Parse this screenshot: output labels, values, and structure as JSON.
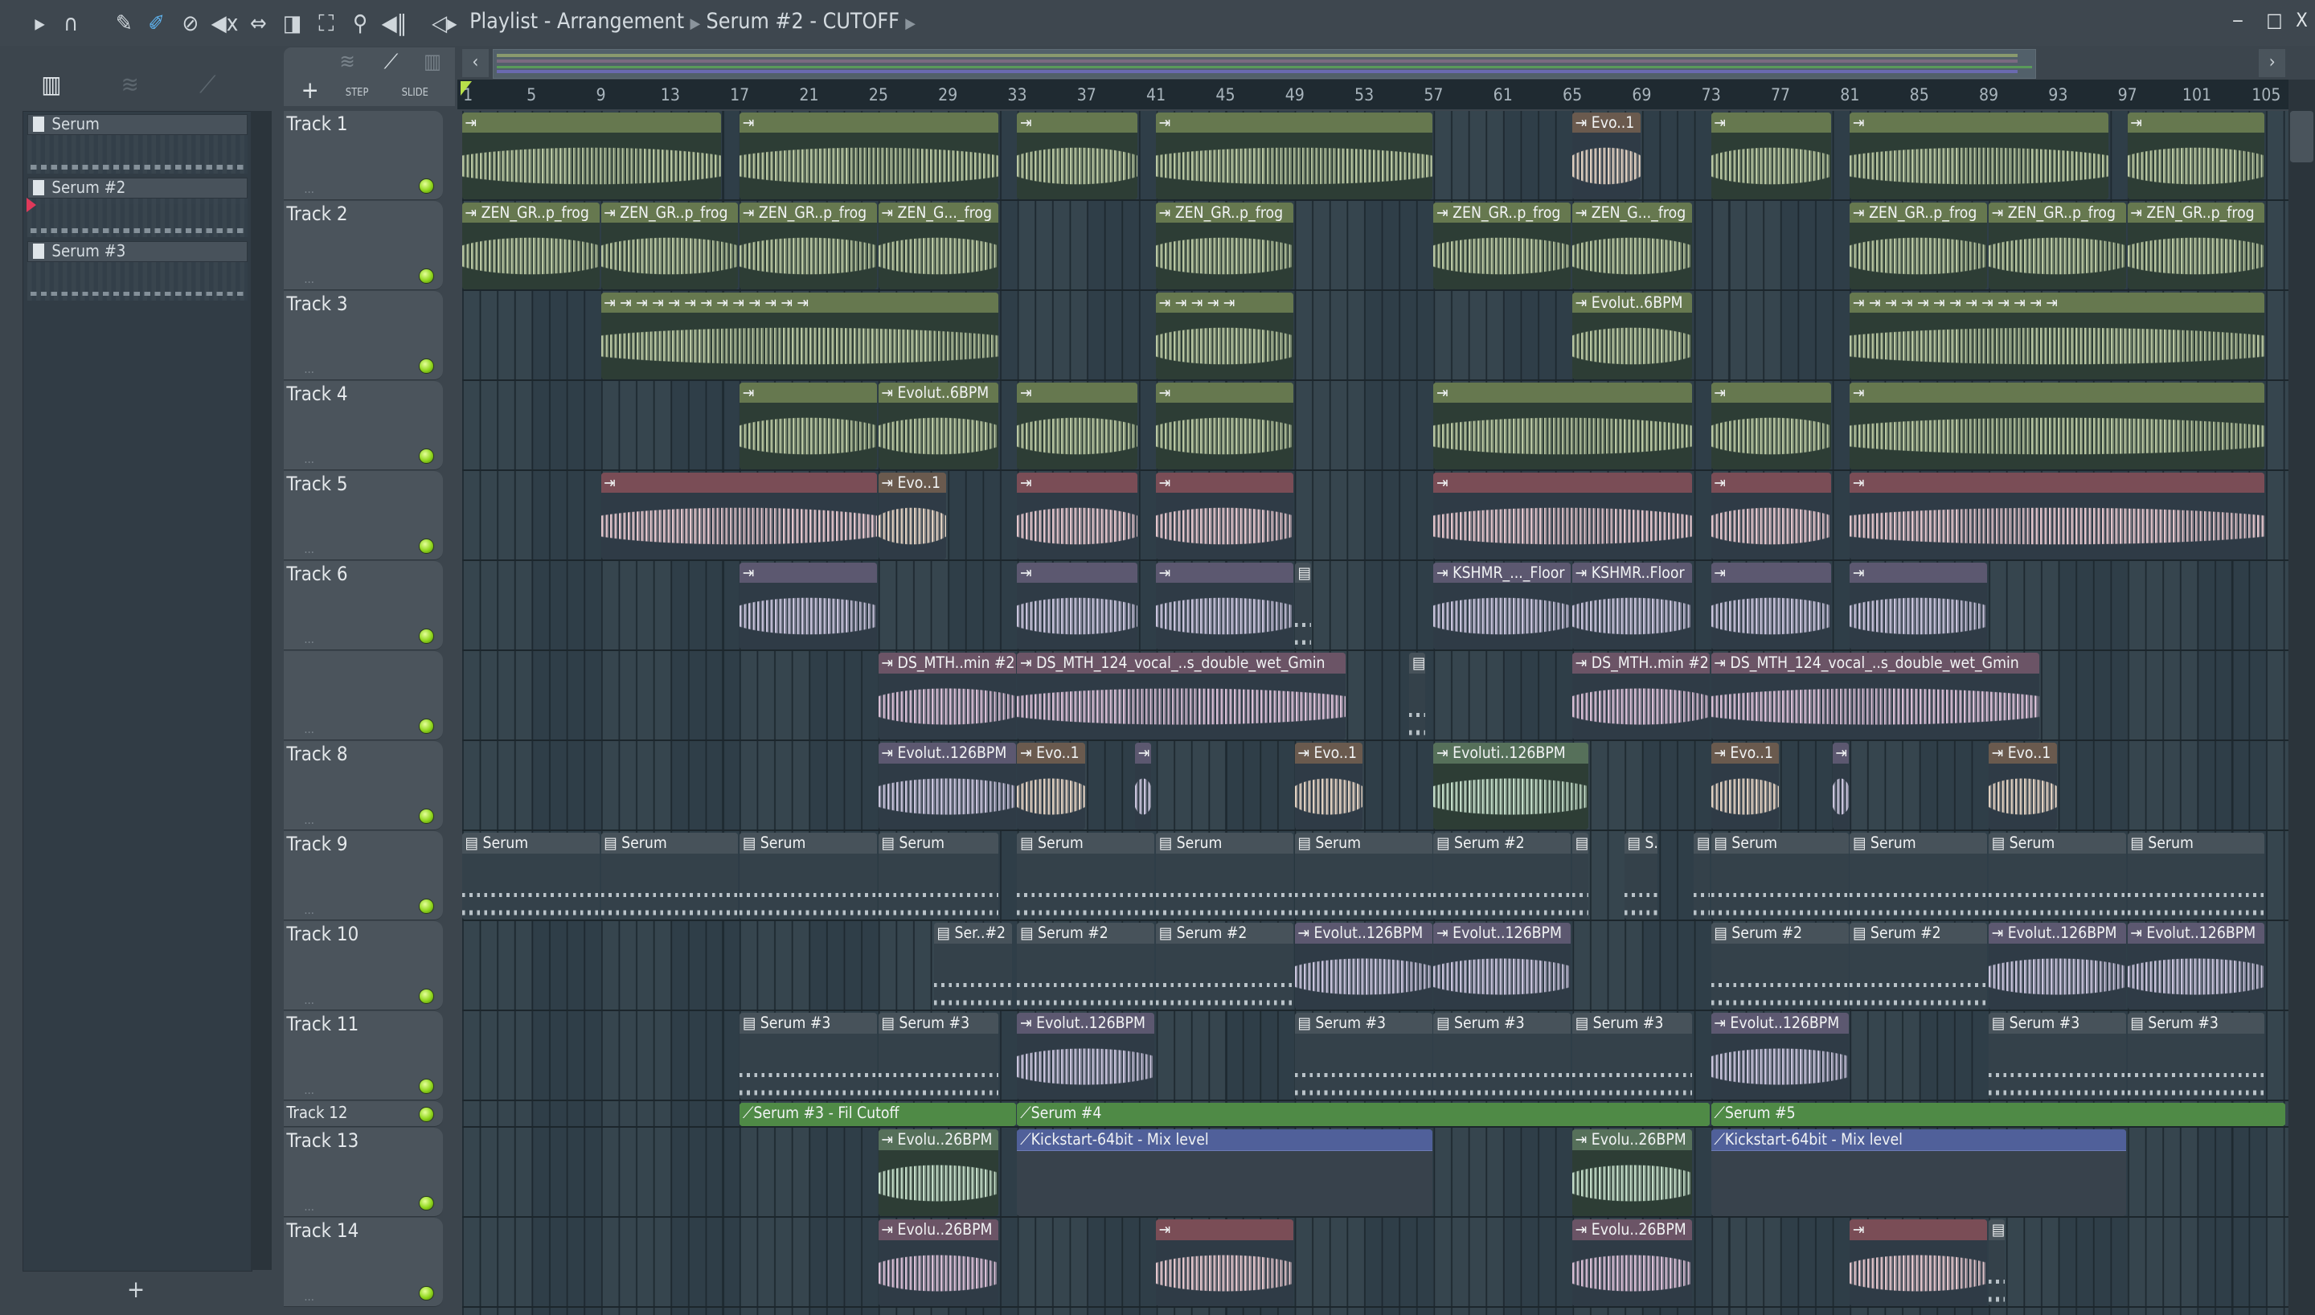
{
  "window": {
    "title": "Playlist - Arrangement",
    "pattern": "Serum #2 - CUTOFF",
    "minimize": "‒",
    "maximize": "□",
    "close": "X"
  },
  "toolbar": {
    "icons": [
      "play-arrow-icon",
      "magnet-snap-icon",
      "pencil-draw-icon",
      "paint-brush-icon",
      "delete-icon",
      "mute-icon",
      "slip-icon",
      "slice-icon",
      "select-icon",
      "zoom-icon",
      "playback-icon",
      "speaker-icon"
    ],
    "step_label": "STEP",
    "slide_label": "SLIDE",
    "add_label": "+"
  },
  "picker": {
    "patterns": [
      {
        "name": "Serum"
      },
      {
        "name": "Serum #2"
      },
      {
        "name": "Serum #3"
      }
    ],
    "add_label": "+"
  },
  "ruler": {
    "bars": [
      "1",
      "5",
      "9",
      "13",
      "17",
      "21",
      "25",
      "29",
      "33",
      "37",
      "41",
      "45",
      "49",
      "53",
      "57",
      "61",
      "65",
      "69",
      "73",
      "77",
      "81",
      "85",
      "89",
      "93",
      "97",
      "101",
      "105"
    ]
  },
  "colors": {
    "olive": "#66784f",
    "mint": "#b9c7a2",
    "pink": "#6b5466",
    "vocal": "#d9bfd6",
    "purple": "#5c5870",
    "brown": "#6a5a4e",
    "grey": "#47525a",
    "auto_green": "#4f8a46",
    "auto_blue": "#50609a",
    "red": "#7a4d56"
  },
  "tracks": [
    {
      "name": "Track 1",
      "clips": [
        {
          "s": 1,
          "l": 15,
          "t": "olive",
          "label": ""
        },
        {
          "s": 17,
          "l": 15,
          "t": "olive",
          "label": ""
        },
        {
          "s": 33,
          "l": 7,
          "t": "olive",
          "label": ""
        },
        {
          "s": 41,
          "l": 16,
          "t": "olive",
          "label": ""
        },
        {
          "s": 65,
          "l": 4,
          "t": "brown",
          "label": "Evo..1"
        },
        {
          "s": 73,
          "l": 7,
          "t": "olive",
          "label": ""
        },
        {
          "s": 81,
          "l": 15,
          "t": "olive",
          "label": ""
        },
        {
          "s": 97,
          "l": 8,
          "t": "olive",
          "label": ""
        }
      ]
    },
    {
      "name": "Track 2",
      "clips": [
        {
          "s": 1,
          "l": 8,
          "t": "olive",
          "label": "ZEN_GR..p_frog"
        },
        {
          "s": 9,
          "l": 8,
          "t": "olive",
          "label": "ZEN_GR..p_frog"
        },
        {
          "s": 17,
          "l": 8,
          "t": "olive",
          "label": "ZEN_GR..p_frog"
        },
        {
          "s": 25,
          "l": 7,
          "t": "olive",
          "label": "ZEN_G..._frog"
        },
        {
          "s": 41,
          "l": 8,
          "t": "olive",
          "label": "ZEN_GR..p_frog"
        },
        {
          "s": 57,
          "l": 8,
          "t": "olive",
          "label": "ZEN_GR..p_frog"
        },
        {
          "s": 65,
          "l": 7,
          "t": "olive",
          "label": "ZEN_G..._frog"
        },
        {
          "s": 81,
          "l": 8,
          "t": "olive",
          "label": "ZEN_GR..p_frog"
        },
        {
          "s": 89,
          "l": 8,
          "t": "olive",
          "label": "ZEN_GR..p_frog"
        },
        {
          "s": 97,
          "l": 8,
          "t": "olive",
          "label": "ZEN_GR..p_frog"
        }
      ]
    },
    {
      "name": "Track 3",
      "clips": [
        {
          "s": 9,
          "l": 23,
          "t": "olive",
          "label": "⇥ ⇥ ⇥ ⇥ ⇥ ⇥ ⇥ ⇥ ⇥ ⇥ ⇥ ⇥"
        },
        {
          "s": 41,
          "l": 8,
          "t": "olive",
          "label": "⇥ ⇥ ⇥ ⇥"
        },
        {
          "s": 65,
          "l": 7,
          "t": "olive",
          "label": "Evolut..6BPM"
        },
        {
          "s": 81,
          "l": 24,
          "t": "olive",
          "label": "⇥ ⇥ ⇥ ⇥ ⇥ ⇥ ⇥ ⇥ ⇥ ⇥ ⇥ ⇥"
        }
      ]
    },
    {
      "name": "Track 4",
      "clips": [
        {
          "s": 17,
          "l": 8,
          "t": "olive",
          "label": ""
        },
        {
          "s": 25,
          "l": 7,
          "t": "olive",
          "label": "Evolut..6BPM"
        },
        {
          "s": 33,
          "l": 7,
          "t": "olive",
          "label": ""
        },
        {
          "s": 41,
          "l": 8,
          "t": "olive",
          "label": ""
        },
        {
          "s": 57,
          "l": 15,
          "t": "olive",
          "label": ""
        },
        {
          "s": 73,
          "l": 7,
          "t": "olive",
          "label": ""
        },
        {
          "s": 81,
          "l": 24,
          "t": "olive",
          "label": ""
        }
      ]
    },
    {
      "name": "Track 5",
      "clips": [
        {
          "s": 9,
          "l": 16,
          "t": "red",
          "label": ""
        },
        {
          "s": 25,
          "l": 4,
          "t": "brown",
          "label": "Evo..1"
        },
        {
          "s": 33,
          "l": 7,
          "t": "red",
          "label": ""
        },
        {
          "s": 41,
          "l": 8,
          "t": "red",
          "label": ""
        },
        {
          "s": 57,
          "l": 15,
          "t": "red",
          "label": ""
        },
        {
          "s": 73,
          "l": 7,
          "t": "red",
          "label": ""
        },
        {
          "s": 81,
          "l": 24,
          "t": "red",
          "label": ""
        }
      ]
    },
    {
      "name": "Track 6",
      "clips": [
        {
          "s": 17,
          "l": 8,
          "t": "purple",
          "label": ""
        },
        {
          "s": 33,
          "l": 7,
          "t": "purple",
          "label": ""
        },
        {
          "s": 41,
          "l": 8,
          "t": "purple",
          "label": ""
        },
        {
          "s": 49,
          "l": 1,
          "t": "grey",
          "label": ""
        },
        {
          "s": 57,
          "l": 8,
          "t": "purple",
          "label": "KSHMR_..._Floor"
        },
        {
          "s": 65,
          "l": 7,
          "t": "purple",
          "label": "KSHMR..Floor"
        },
        {
          "s": 73,
          "l": 7,
          "t": "purple",
          "label": ""
        },
        {
          "s": 81,
          "l": 8,
          "t": "purple",
          "label": ""
        }
      ]
    },
    {
      "name": "",
      "clips": [
        {
          "s": 25,
          "l": 8,
          "t": "pink",
          "label": "DS_MTH..min #2"
        },
        {
          "s": 33,
          "l": 19,
          "t": "pink",
          "label": "DS_MTH_124_vocal_..s_double_wet_Gmin"
        },
        {
          "s": 55.6,
          "l": 1,
          "t": "grey",
          "label": ""
        },
        {
          "s": 65,
          "l": 8,
          "t": "pink",
          "label": "DS_MTH..min #2"
        },
        {
          "s": 73,
          "l": 19,
          "t": "pink",
          "label": "DS_MTH_124_vocal_..s_double_wet_Gmin"
        }
      ]
    },
    {
      "name": "Track 8",
      "clips": [
        {
          "s": 25,
          "l": 8,
          "t": "purple",
          "label": "Evolut..126BPM"
        },
        {
          "s": 33,
          "l": 4,
          "t": "brown",
          "label": "Evo..1"
        },
        {
          "s": 39.8,
          "l": 1,
          "t": "purple",
          "label": ""
        },
        {
          "s": 49,
          "l": 4,
          "t": "brown",
          "label": "Evo..1"
        },
        {
          "s": 57,
          "l": 9,
          "t": "mintc",
          "label": "Evoluti..126BPM"
        },
        {
          "s": 73,
          "l": 4,
          "t": "brown",
          "label": "Evo..1"
        },
        {
          "s": 80,
          "l": 1,
          "t": "purple",
          "label": ""
        },
        {
          "s": 89,
          "l": 4,
          "t": "brown",
          "label": "Evo..1"
        }
      ]
    },
    {
      "name": "Track 9",
      "clips": [
        {
          "s": 1,
          "l": 8,
          "t": "grey",
          "label": "Serum"
        },
        {
          "s": 9,
          "l": 8,
          "t": "grey",
          "label": "Serum"
        },
        {
          "s": 17,
          "l": 8,
          "t": "grey",
          "label": "Serum"
        },
        {
          "s": 25,
          "l": 7,
          "t": "grey",
          "label": "Serum"
        },
        {
          "s": 33,
          "l": 8,
          "t": "grey",
          "label": "Serum"
        },
        {
          "s": 41,
          "l": 8,
          "t": "grey",
          "label": "Serum"
        },
        {
          "s": 49,
          "l": 8,
          "t": "grey",
          "label": "Serum"
        },
        {
          "s": 57,
          "l": 8,
          "t": "grey",
          "label": "Serum #2"
        },
        {
          "s": 65,
          "l": 1,
          "t": "grey",
          "label": ""
        },
        {
          "s": 68,
          "l": 2,
          "t": "grey",
          "label": "S.."
        },
        {
          "s": 72,
          "l": 1,
          "t": "grey",
          "label": ""
        },
        {
          "s": 73,
          "l": 8,
          "t": "grey",
          "label": "Serum"
        },
        {
          "s": 81,
          "l": 8,
          "t": "grey",
          "label": "Serum"
        },
        {
          "s": 89,
          "l": 8,
          "t": "grey",
          "label": "Serum"
        },
        {
          "s": 97,
          "l": 8,
          "t": "grey",
          "label": "Serum"
        }
      ]
    },
    {
      "name": "Track 10",
      "clips": [
        {
          "s": 28.2,
          "l": 4.6,
          "t": "grey",
          "label": "Ser..#2"
        },
        {
          "s": 33,
          "l": 8,
          "t": "grey",
          "label": "Serum #2"
        },
        {
          "s": 41,
          "l": 8,
          "t": "grey",
          "label": "Serum #2"
        },
        {
          "s": 49,
          "l": 8,
          "t": "purple",
          "label": "Evolut..126BPM"
        },
        {
          "s": 57,
          "l": 8,
          "t": "purple",
          "label": "Evolut..126BPM"
        },
        {
          "s": 73,
          "l": 8,
          "t": "grey",
          "label": "Serum #2"
        },
        {
          "s": 81,
          "l": 8,
          "t": "grey",
          "label": "Serum #2"
        },
        {
          "s": 89,
          "l": 8,
          "t": "purple",
          "label": "Evolut..126BPM"
        },
        {
          "s": 97,
          "l": 8,
          "t": "purple",
          "label": "Evolut..126BPM"
        }
      ]
    },
    {
      "name": "Track 11",
      "clips": [
        {
          "s": 17,
          "l": 8,
          "t": "grey",
          "label": "Serum #3"
        },
        {
          "s": 25,
          "l": 7,
          "t": "grey",
          "label": "Serum #3"
        },
        {
          "s": 33,
          "l": 8,
          "t": "purple",
          "label": "Evolut..126BPM"
        },
        {
          "s": 49,
          "l": 8,
          "t": "grey",
          "label": "Serum #3"
        },
        {
          "s": 57,
          "l": 8,
          "t": "grey",
          "label": "Serum #3"
        },
        {
          "s": 65,
          "l": 7,
          "t": "grey",
          "label": "Serum #3"
        },
        {
          "s": 73,
          "l": 8,
          "t": "purple",
          "label": "Evolut..126BPM"
        },
        {
          "s": 89,
          "l": 8,
          "t": "grey",
          "label": "Serum #3"
        },
        {
          "s": 97,
          "l": 8,
          "t": "grey",
          "label": "Serum #3"
        }
      ]
    },
    {
      "name": "Track 12",
      "small": true,
      "clips": [
        {
          "s": 17,
          "l": 16,
          "t": "auto_green",
          "label": "Serum #3 - Fil Cutoff"
        },
        {
          "s": 33,
          "l": 40,
          "t": "auto_green",
          "label": "Serum #4"
        },
        {
          "s": 73,
          "l": 33.2,
          "t": "auto_green",
          "label": "Serum #5"
        }
      ]
    },
    {
      "name": "Track 13",
      "clips": [
        {
          "s": 25,
          "l": 7,
          "t": "mintc",
          "label": "Evolu..26BPM"
        },
        {
          "s": 33,
          "l": 24,
          "t": "auto_blue",
          "label": "Kickstart-64bit - Mix level"
        },
        {
          "s": 65,
          "l": 7,
          "t": "mintc",
          "label": "Evolu..26BPM"
        },
        {
          "s": 73,
          "l": 24,
          "t": "auto_blue",
          "label": "Kickstart-64bit - Mix level"
        }
      ]
    },
    {
      "name": "Track 14",
      "clips": [
        {
          "s": 25,
          "l": 7,
          "t": "pink",
          "label": "Evolu..26BPM"
        },
        {
          "s": 41,
          "l": 8,
          "t": "red",
          "label": ""
        },
        {
          "s": 65,
          "l": 7,
          "t": "pink",
          "label": "Evolu..26BPM"
        },
        {
          "s": 81,
          "l": 8,
          "t": "red",
          "label": ""
        },
        {
          "s": 89,
          "l": 1,
          "t": "grey",
          "label": ""
        }
      ]
    }
  ]
}
